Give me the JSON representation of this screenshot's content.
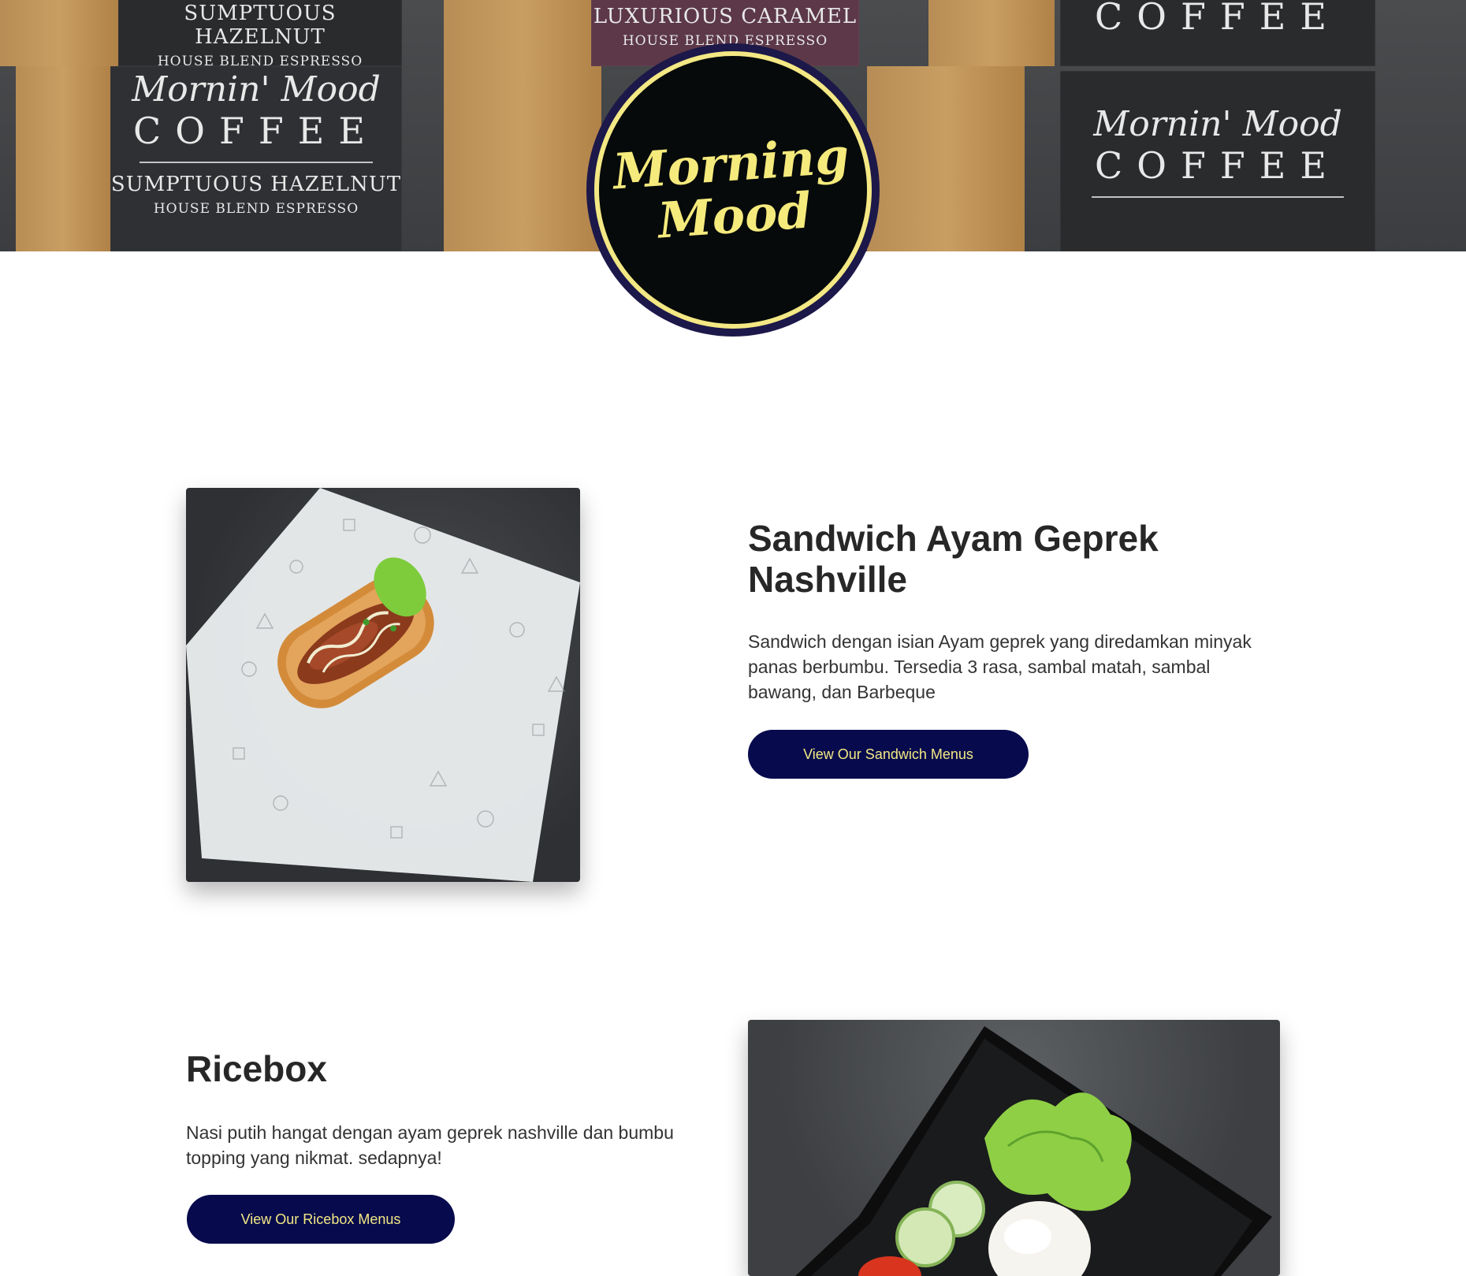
{
  "hero": {
    "bag_top_left_line1": "SUMPTUOUS HAZELNUT",
    "bag_top_left_line2": "HOUSE BLEND ESPRESSO",
    "bag_top_center_line1": "LUXURIOUS CARAMEL",
    "bag_top_center_line2": "HOUSE BLEND ESPRESSO",
    "bag_left_brand": "Mornin' Mood",
    "bag_left_coffee": "COFFEE",
    "bag_left_line1": "SUMPTUOUS HAZELNUT",
    "bag_left_line2": "HOUSE BLEND ESPRESSO",
    "bag_right_brand": "Mornin' Mood",
    "bag_right_coffee": "COFFEE",
    "bag_top_right_coffee": "COFFEE"
  },
  "logo": {
    "line1": "Morning",
    "line2": "Mood"
  },
  "menu": [
    {
      "title": "Sandwich Ayam Geprek Nashville",
      "description": "Sandwich dengan isian Ayam geprek yang diredamkan minyak panas berbumbu. Tersedia 3 rasa, sambal matah, sambal bawang, dan Barbeque",
      "button_label": "View Our Sandwich Menus"
    },
    {
      "title": "Ricebox",
      "description": "Nasi putih hangat dengan ayam geprek nashville dan bumbu topping yang nikmat. sedapnya!",
      "button_label": "View Our Ricebox Menus"
    }
  ],
  "colors": {
    "accent_navy": "#070b4d",
    "accent_yellow": "#f3e884",
    "logo_ring": "#1c1849"
  }
}
